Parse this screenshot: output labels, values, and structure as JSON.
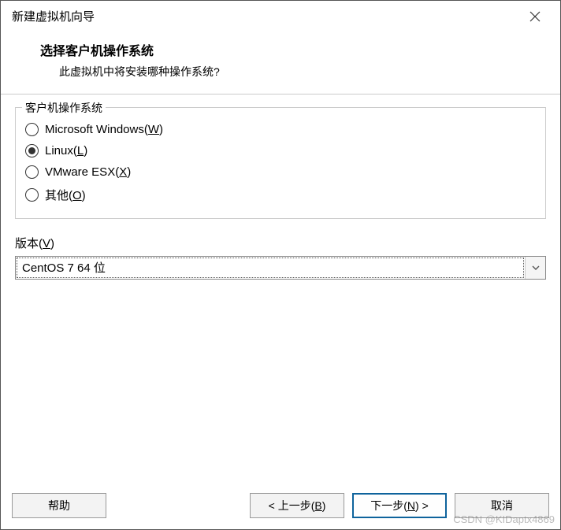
{
  "window": {
    "title": "新建虚拟机向导"
  },
  "header": {
    "title": "选择客户机操作系统",
    "subtitle": "此虚拟机中将安装哪种操作系统?"
  },
  "os_group": {
    "legend": "客户机操作系统",
    "options": [
      {
        "label": "Microsoft Windows(",
        "mnemonic": "W",
        "suffix": ")",
        "checked": false
      },
      {
        "label": "Linux(",
        "mnemonic": "L",
        "suffix": ")",
        "checked": true
      },
      {
        "label": "VMware ESX(",
        "mnemonic": "X",
        "suffix": ")",
        "checked": false
      },
      {
        "label": "其他(",
        "mnemonic": "O",
        "suffix": ")",
        "checked": false
      }
    ]
  },
  "version": {
    "label_prefix": "版本(",
    "label_mnemonic": "V",
    "label_suffix": ")",
    "selected": "CentOS 7 64 位"
  },
  "buttons": {
    "help": "帮助",
    "back_prefix": "< 上一步(",
    "back_mnemonic": "B",
    "back_suffix": ")",
    "next_prefix": "下一步(",
    "next_mnemonic": "N",
    "next_suffix": ") >",
    "cancel": "取消"
  },
  "watermark": "CSDN @KIDaptx4869"
}
